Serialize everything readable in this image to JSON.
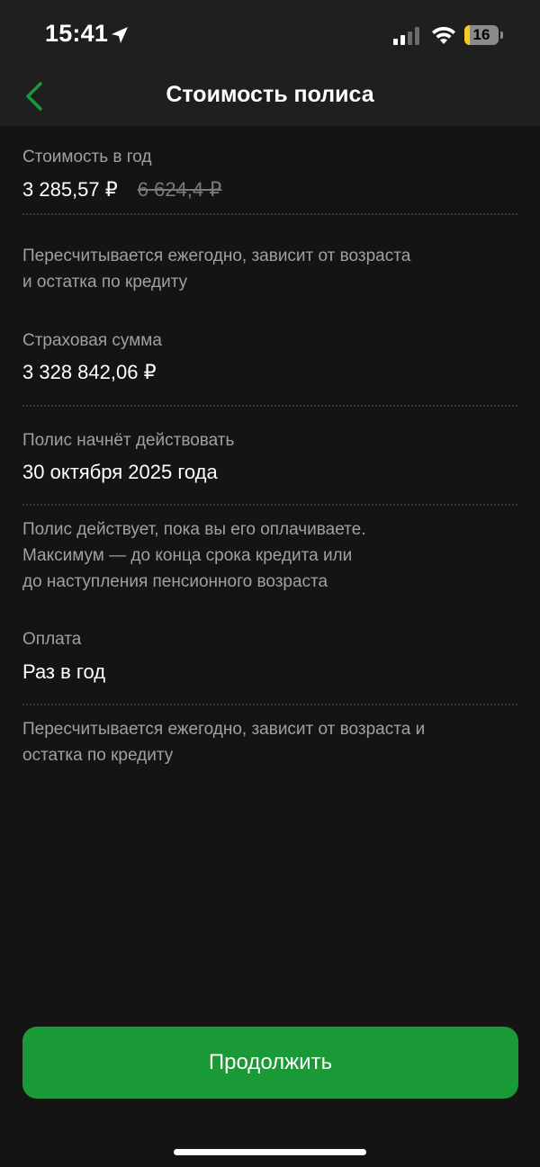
{
  "status_bar": {
    "time": "15:41",
    "battery_percent": "16",
    "battery_level": 0.16,
    "icons": [
      "location-arrow-icon",
      "cellular-signal-icon",
      "wifi-icon",
      "battery-icon"
    ]
  },
  "header": {
    "title": "Стоимость полиса",
    "back_icon": "chevron-left-icon",
    "accent_color": "#1a9937"
  },
  "sections": {
    "annual_cost": {
      "label": "Стоимость в год",
      "price": "3 285,57 ₽",
      "old_price": "6 624,4 ₽",
      "note": "Пересчитывается ежегодно, зависит от возраста и остатка по кредиту",
      "note_lines": [
        "Пересчитывается ежегодно, зависит от возраста",
        "и остатка по кредиту"
      ]
    },
    "insured_sum": {
      "label": "Страховая сумма",
      "value": "3 328 842,06 ₽"
    },
    "policy_start": {
      "label": "Полис начнёт действовать",
      "value": "30 октября 2025 года",
      "note_lines": [
        "Полис действует, пока вы его оплачиваете.",
        "Максимум — до конца срока кредита или",
        "до наступления пенсионного возраста"
      ]
    },
    "payment": {
      "label": "Оплата",
      "value": "Раз в год",
      "note_lines": [
        "Пересчитывается ежегодно, зависит от возраста и",
        "остатка по кредиту"
      ]
    }
  },
  "footer": {
    "continue_label": "Продолжить",
    "button_color": "#1a9937"
  }
}
